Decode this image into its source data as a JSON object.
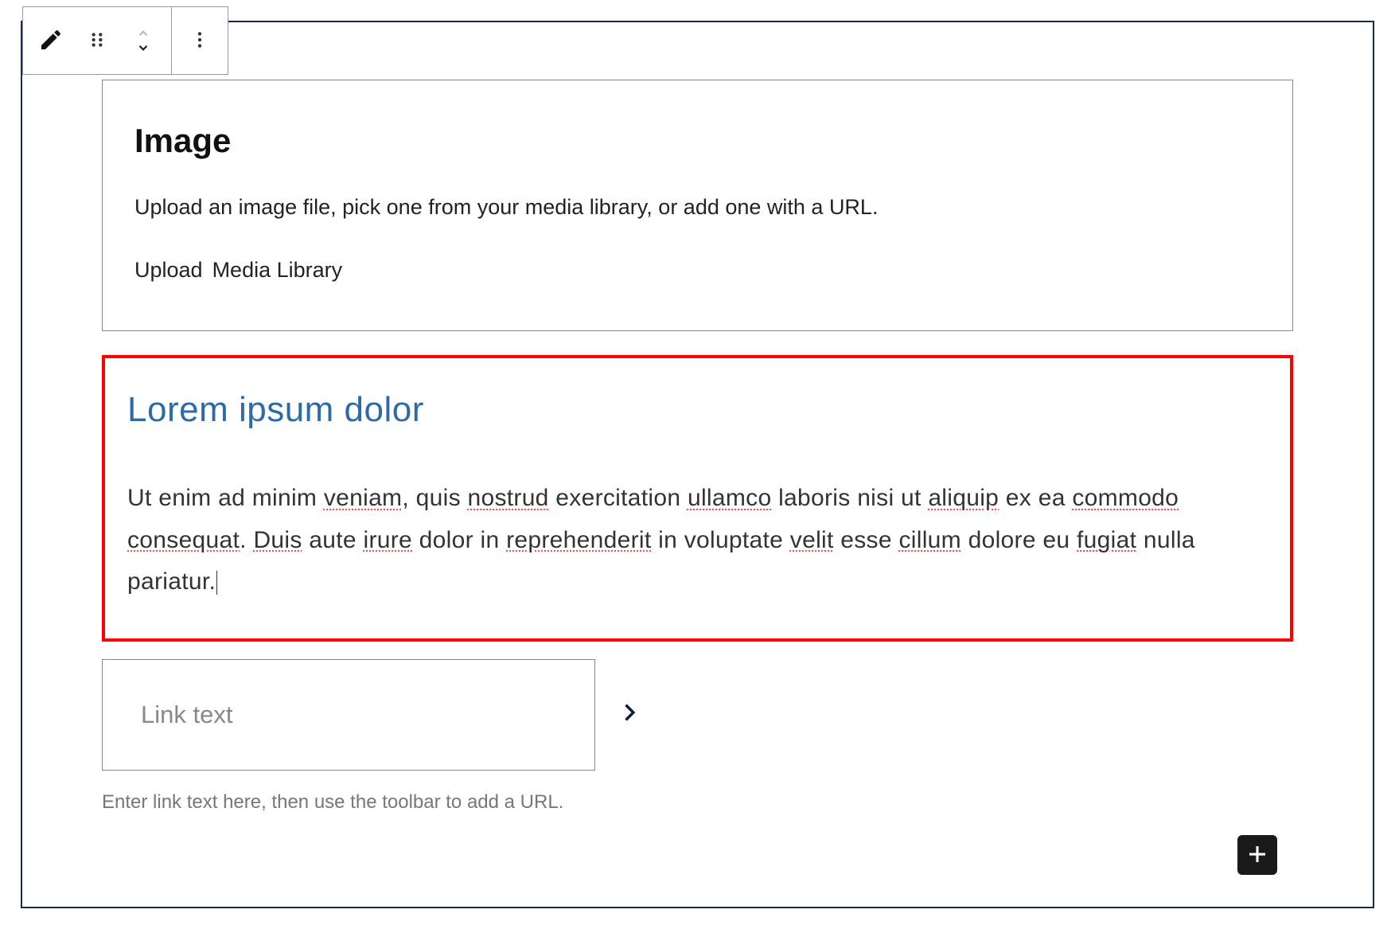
{
  "toolbar": {
    "edit_icon": "pencil-icon",
    "drag_icon": "drag-handle-icon",
    "move_up_icon": "chevron-up-icon",
    "move_down_icon": "chevron-down-icon",
    "options_icon": "more-vertical-icon"
  },
  "image_block": {
    "title": "Image",
    "description": "Upload an image file, pick one from your media library, or add one with a URL.",
    "upload_label": "Upload",
    "media_library_label": "Media Library"
  },
  "selected_block": {
    "heading": "Lorem ipsum dolor",
    "paragraph_parts": [
      {
        "text": "Ut enim ad minim ",
        "spell": false
      },
      {
        "text": "veniam",
        "spell": true
      },
      {
        "text": ", quis ",
        "spell": false
      },
      {
        "text": "nostrud",
        "spell": true
      },
      {
        "text": " exercitation ",
        "spell": false
      },
      {
        "text": "ullamco",
        "spell": true
      },
      {
        "text": " laboris nisi ut ",
        "spell": false
      },
      {
        "text": "aliquip",
        "spell": true
      },
      {
        "text": " ex ea ",
        "spell": false
      },
      {
        "text": "commodo",
        "spell": true
      },
      {
        "text": " ",
        "spell": false
      },
      {
        "text": "consequat",
        "spell": true
      },
      {
        "text": ". ",
        "spell": false
      },
      {
        "text": "Duis",
        "spell": true
      },
      {
        "text": " aute ",
        "spell": false
      },
      {
        "text": "irure",
        "spell": true
      },
      {
        "text": " dolor in ",
        "spell": false
      },
      {
        "text": "reprehenderit",
        "spell": true
      },
      {
        "text": " in voluptate ",
        "spell": false
      },
      {
        "text": "velit",
        "spell": true
      },
      {
        "text": " esse ",
        "spell": false
      },
      {
        "text": "cillum",
        "spell": true
      },
      {
        "text": " dolore eu ",
        "spell": false
      },
      {
        "text": "fugiat",
        "spell": true
      },
      {
        "text": " nulla pariatur.",
        "spell": false
      }
    ]
  },
  "link_block": {
    "placeholder": "Link text",
    "arrow_icon": "chevron-right-icon",
    "helper": "Enter link text here, then use the toolbar to add a URL."
  },
  "add_button": {
    "icon": "plus-icon"
  }
}
